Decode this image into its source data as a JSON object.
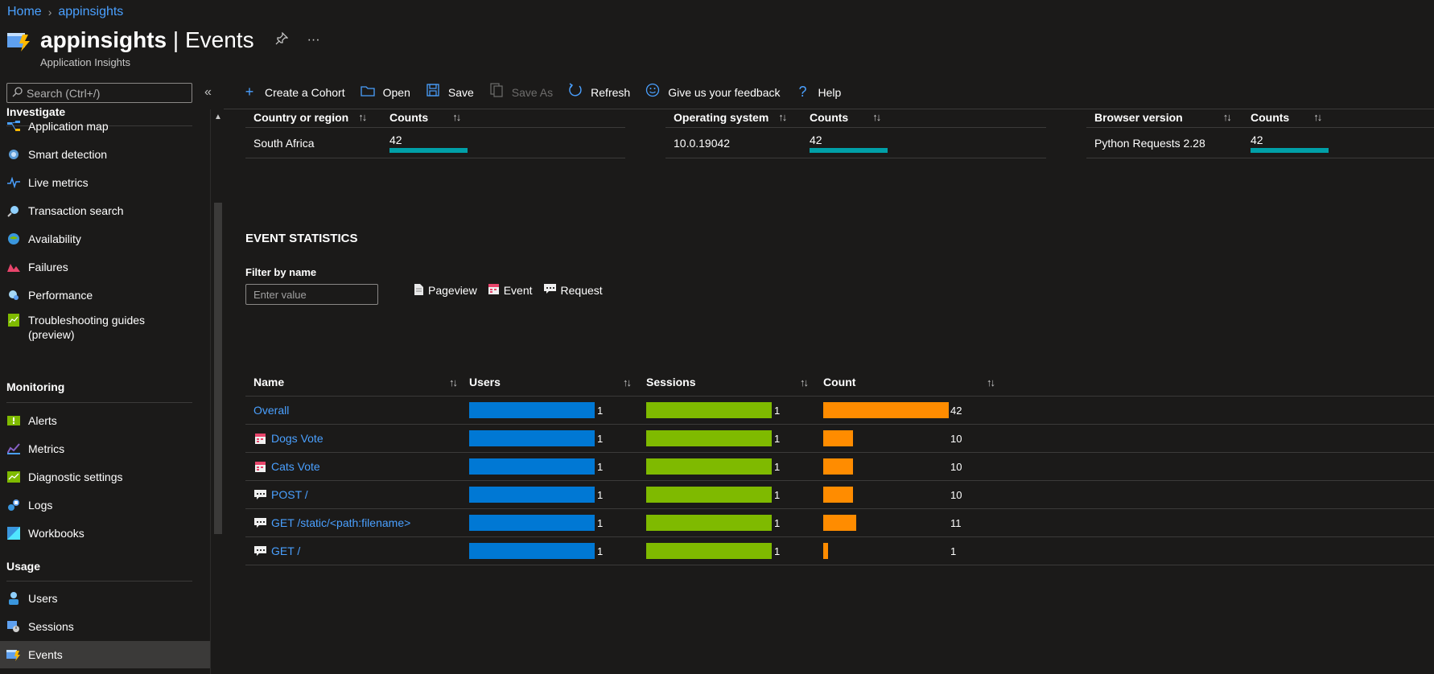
{
  "breadcrumb": {
    "home": "Home",
    "resource": "appinsights"
  },
  "header": {
    "title": "appinsights",
    "title_sep": " | ",
    "page": "Events",
    "subtitle": "Application Insights",
    "pin_icon": "pin-icon",
    "more_icon": "more-icon"
  },
  "sidebar": {
    "search_placeholder": "Search (Ctrl+/)",
    "sections": {
      "investigate": "Investigate",
      "monitoring": "Monitoring",
      "usage": "Usage"
    },
    "investigate_items": [
      {
        "label": "Application map",
        "icon": "application-map-icon"
      },
      {
        "label": "Smart detection",
        "icon": "smart-detection-icon"
      },
      {
        "label": "Live metrics",
        "icon": "live-metrics-icon"
      },
      {
        "label": "Transaction search",
        "icon": "transaction-search-icon"
      },
      {
        "label": "Availability",
        "icon": "availability-icon"
      },
      {
        "label": "Failures",
        "icon": "failures-icon"
      },
      {
        "label": "Performance",
        "icon": "performance-icon"
      },
      {
        "label": "Troubleshooting guides",
        "label2": "(preview)",
        "icon": "troubleshooting-icon"
      }
    ],
    "monitoring_items": [
      {
        "label": "Alerts",
        "icon": "alerts-icon"
      },
      {
        "label": "Metrics",
        "icon": "metrics-icon"
      },
      {
        "label": "Diagnostic settings",
        "icon": "diagnostic-settings-icon"
      },
      {
        "label": "Logs",
        "icon": "logs-icon"
      },
      {
        "label": "Workbooks",
        "icon": "workbooks-icon"
      }
    ],
    "usage_items": [
      {
        "label": "Users",
        "icon": "users-icon"
      },
      {
        "label": "Sessions",
        "icon": "sessions-icon"
      },
      {
        "label": "Events",
        "icon": "events-icon",
        "active": true
      }
    ]
  },
  "toolbar": {
    "create_cohort": "Create a Cohort",
    "open": "Open",
    "save": "Save",
    "save_as": "Save As",
    "refresh": "Refresh",
    "feedback": "Give us your feedback",
    "help": "Help"
  },
  "mini_tables": [
    {
      "col1": "Country or region",
      "col2": "Counts",
      "row_label": "South Africa",
      "row_count": "42"
    },
    {
      "col1": "Operating system",
      "col2": "Counts",
      "row_label": "10.0.19042",
      "row_count": "42"
    },
    {
      "col1": "Browser version",
      "col2": "Counts",
      "row_label": "Python Requests 2.28",
      "row_count": "42"
    }
  ],
  "event_stats": {
    "title": "EVENT STATISTICS",
    "filter_label": "Filter by name",
    "filter_placeholder": "Enter value",
    "legend": {
      "pageview": "Pageview",
      "event": "Event",
      "request": "Request"
    },
    "columns": {
      "name": "Name",
      "users": "Users",
      "sessions": "Sessions",
      "count": "Count"
    },
    "rows": [
      {
        "name": "Overall",
        "type": "overall",
        "users": "1",
        "sessions": "1",
        "count": "42",
        "count_fraction": 1.0
      },
      {
        "name": "Dogs Vote",
        "type": "event",
        "users": "1",
        "sessions": "1",
        "count": "10",
        "count_fraction": 0.238
      },
      {
        "name": "Cats Vote",
        "type": "event",
        "users": "1",
        "sessions": "1",
        "count": "10",
        "count_fraction": 0.238
      },
      {
        "name": "POST /",
        "type": "request",
        "users": "1",
        "sessions": "1",
        "count": "10",
        "count_fraction": 0.238
      },
      {
        "name": "GET /static/<path:filename>",
        "type": "request",
        "users": "1",
        "sessions": "1",
        "count": "11",
        "count_fraction": 0.262
      },
      {
        "name": "GET /",
        "type": "request",
        "users": "1",
        "sessions": "1",
        "count": "1",
        "count_fraction": 0.024
      }
    ]
  },
  "colors": {
    "users_bar": "#0078d4",
    "sessions_bar": "#7fba00",
    "count_bar": "#ff8c00",
    "counts_bar": "#00a0a8",
    "link": "#4aa0ff"
  }
}
